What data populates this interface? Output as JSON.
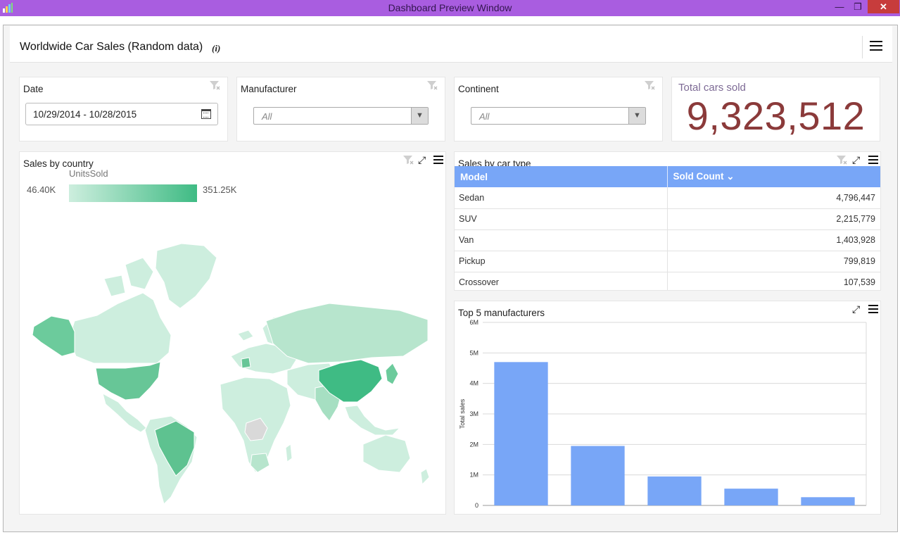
{
  "window": {
    "title": "Dashboard Preview Window",
    "minimize_glyph": "—",
    "restore_glyph": "❐",
    "close_glyph": "✕"
  },
  "dashboard": {
    "title": "Worldwide Car Sales (Random data)",
    "info_glyph": "(i)"
  },
  "filters": {
    "date": {
      "label": "Date",
      "value": "10/29/2014 - 10/28/2015"
    },
    "manufacturer": {
      "label": "Manufacturer",
      "placeholder": "All"
    },
    "continent": {
      "label": "Continent",
      "placeholder": "All"
    }
  },
  "kpi": {
    "label": "Total cars sold",
    "value": "9,323,512"
  },
  "map_panel": {
    "title": "Sales by country",
    "legend_title": "UnitsSold",
    "legend_min": "46.40K",
    "legend_max": "351.25K",
    "colors": {
      "low": "#cdeede",
      "high": "#3fbb84",
      "no_data": "#d9d9d9"
    }
  },
  "table_panel": {
    "title": "Sales by car type",
    "columns": [
      "Model",
      "Sold Count"
    ],
    "sort_glyph": "⌄",
    "rows": [
      {
        "model": "Sedan",
        "count": "4,796,447"
      },
      {
        "model": "SUV",
        "count": "2,215,779"
      },
      {
        "model": "Van",
        "count": "1,403,928"
      },
      {
        "model": "Pickup",
        "count": "799,819"
      },
      {
        "model": "Crossover",
        "count": "107,539"
      }
    ]
  },
  "chart_panel": {
    "title": "Top 5 manufacturers"
  },
  "colors": {
    "title_bar": "#a95de0",
    "accent_blue": "#78a6f7",
    "kpi_value": "#8b3a3a"
  },
  "chart_data": {
    "type": "bar",
    "ylabel": "Total sales",
    "ylim": [
      0,
      6000000
    ],
    "yticks": [
      "0",
      "1M",
      "2M",
      "3M",
      "4M",
      "5M",
      "6M"
    ],
    "categories": [
      "",
      "",
      "",
      "",
      ""
    ],
    "values": [
      4700000,
      1950000,
      950000,
      550000,
      270000
    ],
    "bar_color": "#78a6f7",
    "grid": true
  }
}
